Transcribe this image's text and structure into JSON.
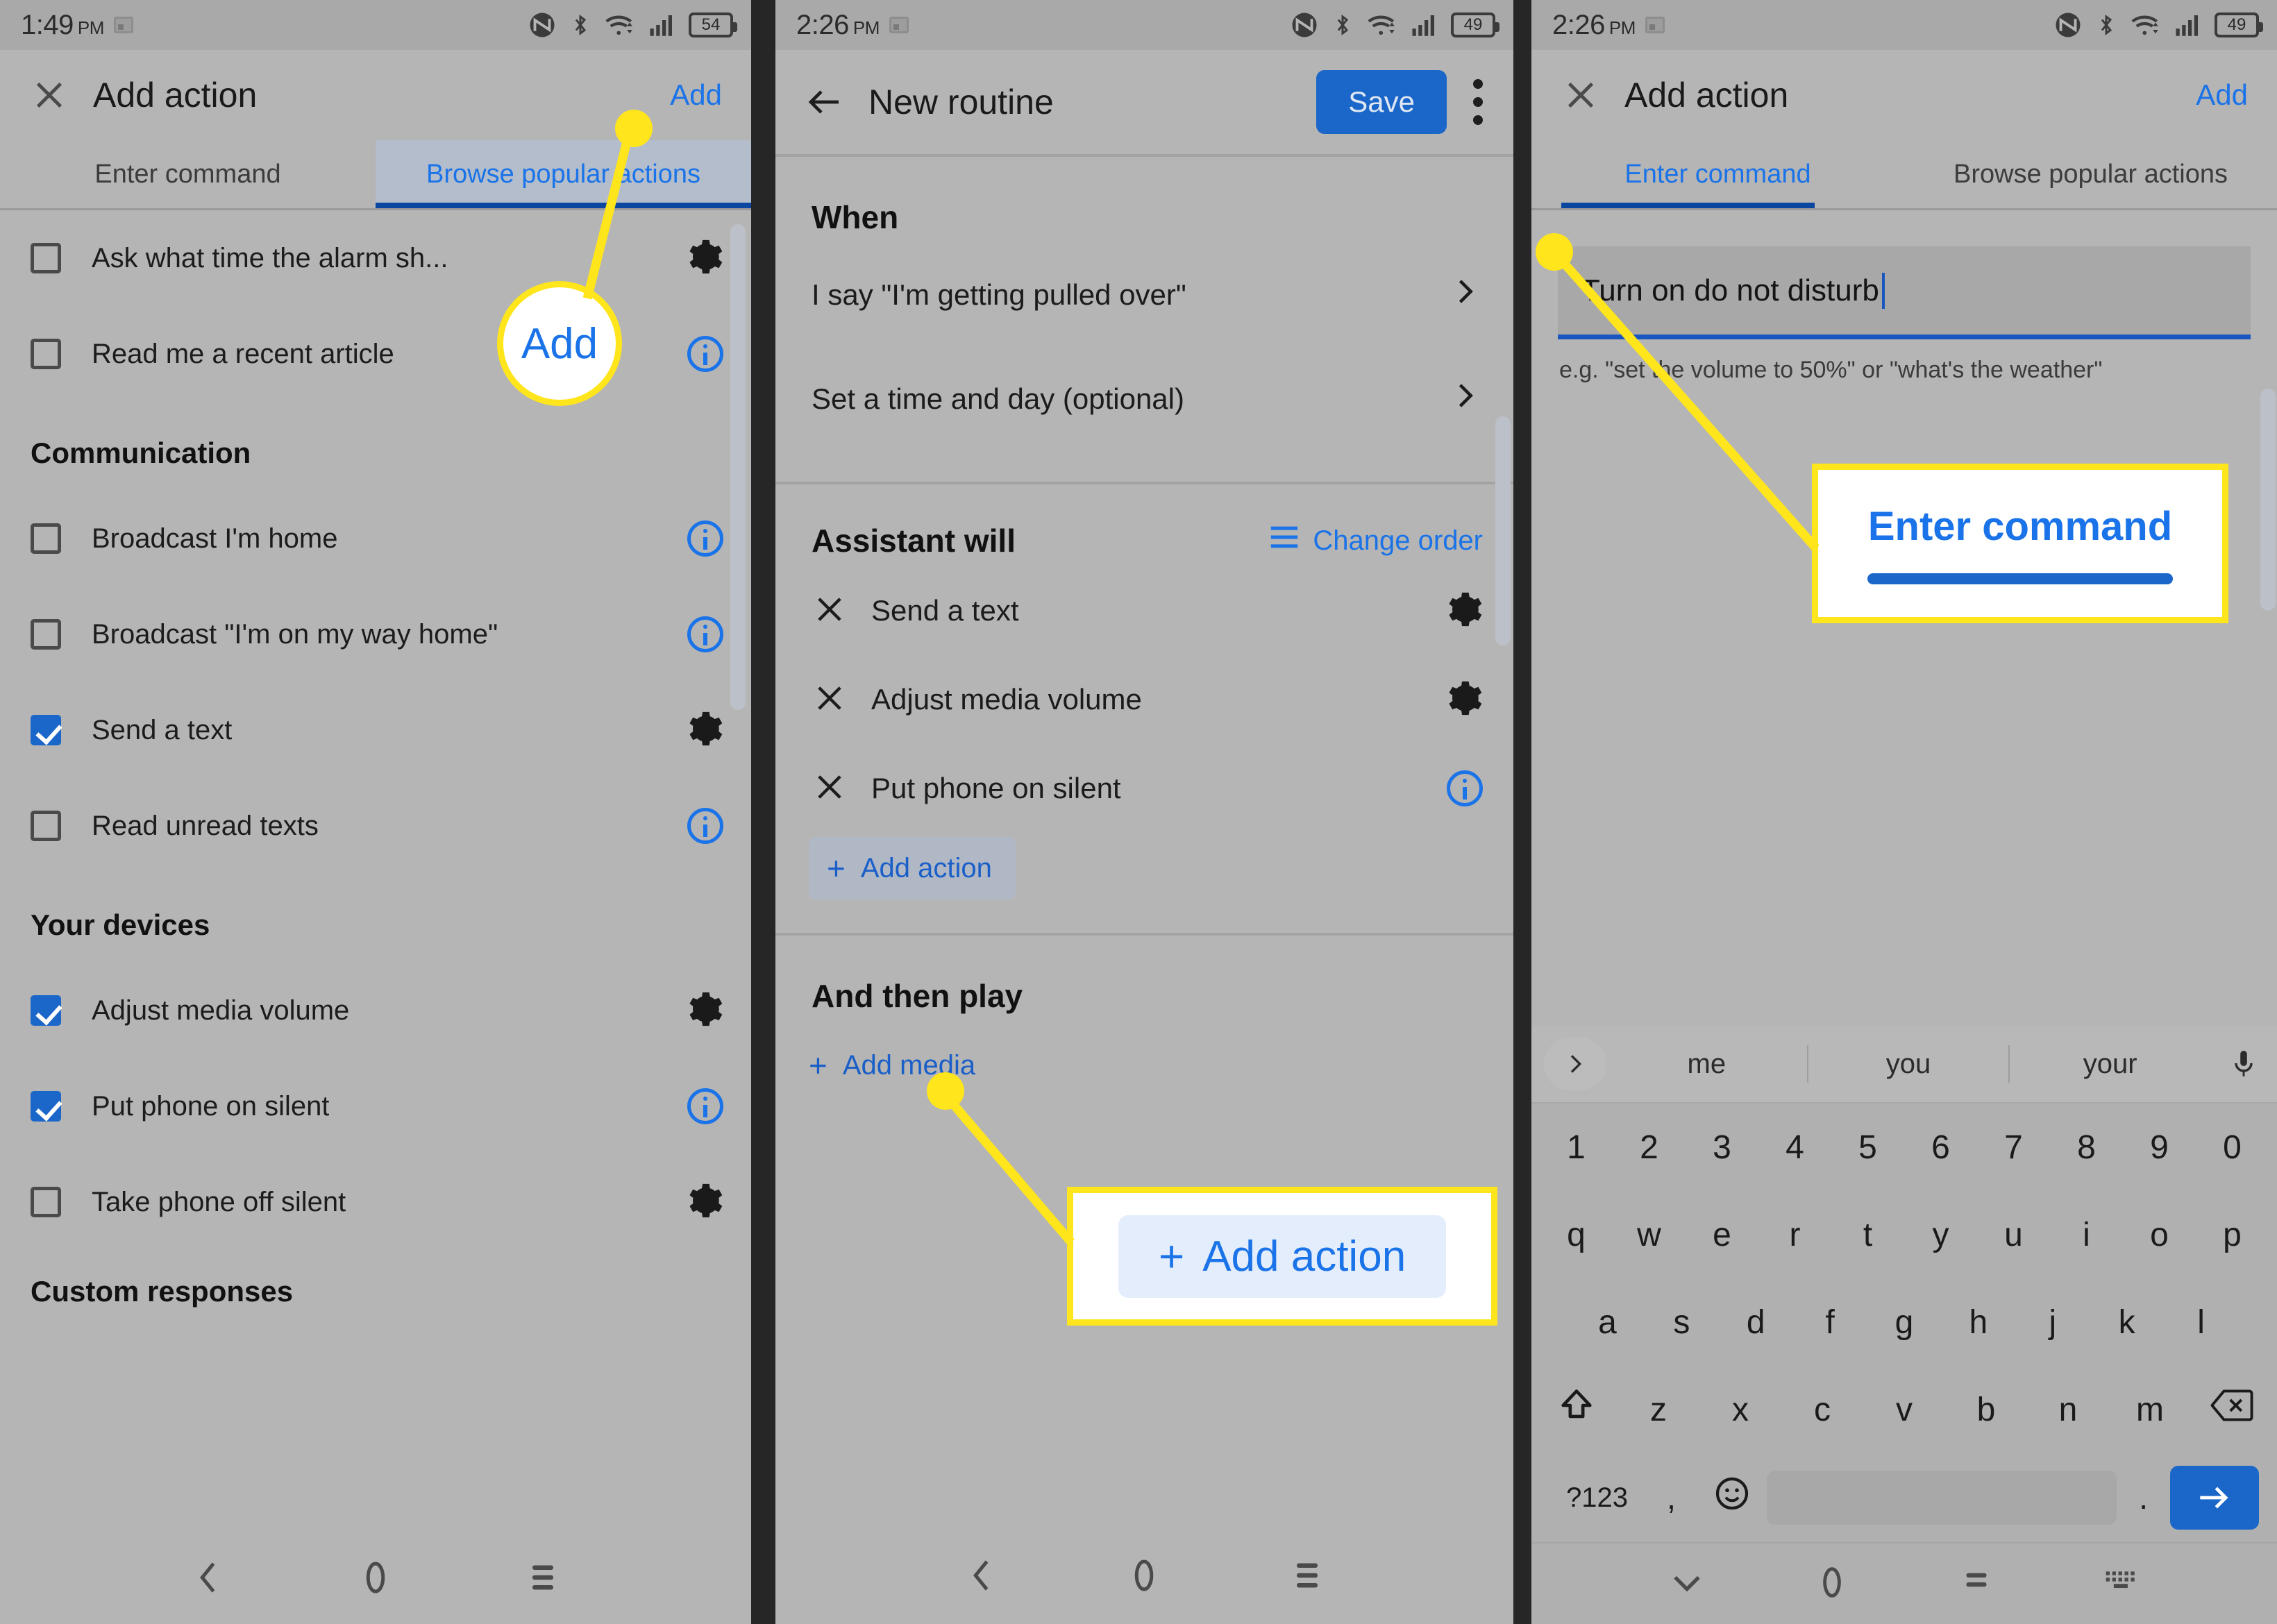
{
  "panel1": {
    "status": {
      "time": "1:49",
      "ampm": "PM",
      "battery": "54"
    },
    "appbar": {
      "close_icon": "close-icon",
      "title": "Add action",
      "action": "Add"
    },
    "tabs": [
      {
        "label": "Enter command",
        "active": false
      },
      {
        "label": "Browse popular actions",
        "active": true
      }
    ],
    "partial_rows": [
      {
        "label": "Ask what time the alarm sh...",
        "checked": false,
        "trail": "gear-icon"
      },
      {
        "label": "Read me a recent article",
        "checked": false,
        "trail": "info-icon"
      }
    ],
    "sections": [
      {
        "title": "Communication",
        "rows": [
          {
            "label": "Broadcast I'm home",
            "checked": false,
            "trail": "info-icon"
          },
          {
            "label": "Broadcast \"I'm on my way home\"",
            "checked": false,
            "trail": "info-icon"
          },
          {
            "label": "Send a text",
            "checked": true,
            "trail": "gear-icon"
          },
          {
            "label": "Read unread texts",
            "checked": false,
            "trail": "info-icon"
          }
        ]
      },
      {
        "title": "Your devices",
        "rows": [
          {
            "label": "Adjust media volume",
            "checked": true,
            "trail": "gear-icon"
          },
          {
            "label": "Put phone on silent",
            "checked": true,
            "trail": "info-icon"
          },
          {
            "label": "Take phone off silent",
            "checked": false,
            "trail": "gear-icon"
          }
        ]
      }
    ],
    "last_section": "Custom responses",
    "callout": {
      "label": "Add"
    }
  },
  "panel2": {
    "status": {
      "time": "2:26",
      "ampm": "PM",
      "battery": "49"
    },
    "appbar": {
      "back_icon": "back-arrow-icon",
      "title": "New routine",
      "save": "Save",
      "overflow_icon": "more-vertical-icon"
    },
    "when": {
      "title": "When",
      "rows": [
        {
          "label": "I say \"I'm getting pulled over\""
        },
        {
          "label": "Set a time and day (optional)"
        }
      ]
    },
    "assistant": {
      "title": "Assistant will",
      "change_order": "Change order",
      "rows": [
        {
          "label": "Send a text",
          "trail": "gear-icon"
        },
        {
          "label": "Adjust media volume",
          "trail": "gear-icon"
        },
        {
          "label": "Put phone on silent",
          "trail": "info-icon"
        }
      ],
      "add_action": "Add action"
    },
    "then_play": {
      "title": "And then play",
      "add_media": "Add media"
    },
    "callout": {
      "label": "Add action"
    }
  },
  "panel3": {
    "status": {
      "time": "2:26",
      "ampm": "PM",
      "battery": "49"
    },
    "appbar": {
      "close_icon": "close-icon",
      "title": "Add action",
      "action": "Add"
    },
    "tabs": [
      {
        "label": "Enter command",
        "active": true
      },
      {
        "label": "Browse popular actions",
        "active": false
      }
    ],
    "command_field": {
      "value": "Turn on do not disturb",
      "placeholder": "Enter command"
    },
    "hint": "e.g. \"set the volume to 50%\" or \"what's the weather\"",
    "callout": {
      "label": "Enter command"
    },
    "keyboard": {
      "suggestions": [
        "me",
        "you",
        "your"
      ],
      "expand_icon": "chevron-right-icon",
      "mic_icon": "microphone-icon",
      "row_numbers": [
        "1",
        "2",
        "3",
        "4",
        "5",
        "6",
        "7",
        "8",
        "9",
        "0"
      ],
      "row_top": [
        "q",
        "w",
        "e",
        "r",
        "t",
        "y",
        "u",
        "i",
        "o",
        "p"
      ],
      "row_home": [
        "a",
        "s",
        "d",
        "f",
        "g",
        "h",
        "j",
        "k",
        "l"
      ],
      "row_bottom": [
        "z",
        "x",
        "c",
        "v",
        "b",
        "n",
        "m"
      ],
      "shift_icon": "shift-icon",
      "backspace_icon": "backspace-icon",
      "symbols_key": "?123",
      "comma_key": ",",
      "emoji_icon": "emoji-icon",
      "period_key": ".",
      "enter_icon": "enter-arrow-icon"
    }
  },
  "colors": {
    "accent_blue": "#1a73e8",
    "button_blue": "#1a66c9",
    "highlight_yellow": "#ffe51c",
    "panel_bg": "#b5b5b5"
  }
}
